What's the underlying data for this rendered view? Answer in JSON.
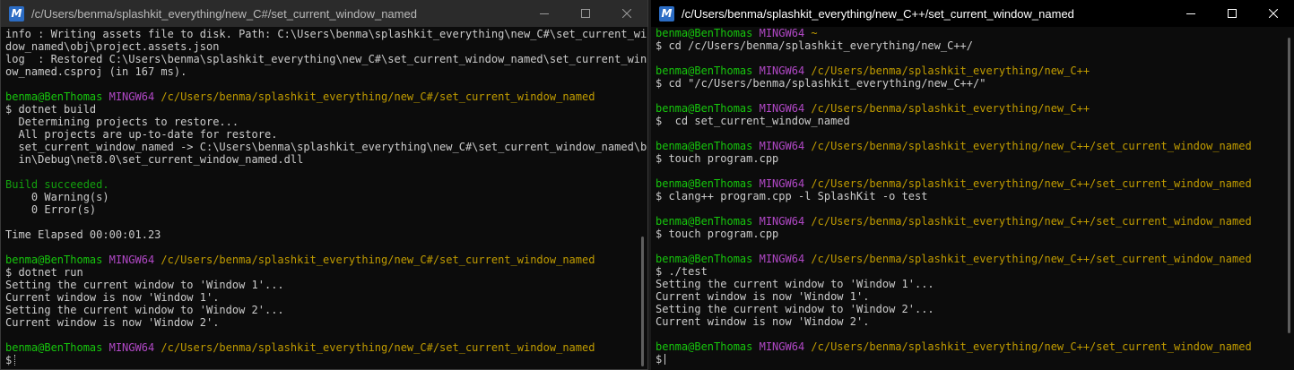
{
  "windows": {
    "left": {
      "title": "/c/Users/benma/splashkit_everything/new_C#/set_current_window_named",
      "icon": "msys2-icon",
      "lines": [
        [
          {
            "t": "info : Writing assets file to disk. Path: C:\\Users\\benma\\splashkit_everything\\new_C#\\set_current_win",
            "c": "white"
          }
        ],
        [
          {
            "t": "dow_named\\obj\\project.assets.json",
            "c": "white"
          }
        ],
        [
          {
            "t": "log  : Restored C:\\Users\\benma\\splashkit_everything\\new_C#\\set_current_window_named\\set_current_wind",
            "c": "white"
          }
        ],
        [
          {
            "t": "ow_named.csproj (in 167 ms).",
            "c": "white"
          }
        ],
        [],
        [
          {
            "t": "benma@BenThomas ",
            "c": "green"
          },
          {
            "t": "MINGW64 ",
            "c": "magenta"
          },
          {
            "t": "/c/Users/benma/splashkit_everything/new_C#/set_current_window_named",
            "c": "yellow"
          }
        ],
        [
          {
            "t": "$ dotnet build",
            "c": "white"
          }
        ],
        [
          {
            "t": "  Determining projects to restore...",
            "c": "white"
          }
        ],
        [
          {
            "t": "  All projects are up-to-date for restore.",
            "c": "white"
          }
        ],
        [
          {
            "t": "  set_current_window_named -> C:\\Users\\benma\\splashkit_everything\\new_C#\\set_current_window_named\\b",
            "c": "white"
          }
        ],
        [
          {
            "t": "  in\\Debug\\net8.0\\set_current_window_named.dll",
            "c": "white"
          }
        ],
        [],
        [
          {
            "t": "Build succeeded.",
            "c": "green2"
          }
        ],
        [
          {
            "t": "    0 Warning(s)",
            "c": "white"
          }
        ],
        [
          {
            "t": "    0 Error(s)",
            "c": "white"
          }
        ],
        [],
        [
          {
            "t": "Time Elapsed 00:00:01.23",
            "c": "white"
          }
        ],
        [],
        [
          {
            "t": "benma@BenThomas ",
            "c": "green"
          },
          {
            "t": "MINGW64 ",
            "c": "magenta"
          },
          {
            "t": "/c/Users/benma/splashkit_everything/new_C#/set_current_window_named",
            "c": "yellow"
          }
        ],
        [
          {
            "t": "$ dotnet run",
            "c": "white"
          }
        ],
        [
          {
            "t": "Setting the current window to 'Window 1'...",
            "c": "white"
          }
        ],
        [
          {
            "t": "Current window is now 'Window 1'.",
            "c": "white"
          }
        ],
        [
          {
            "t": "Setting the current window to 'Window 2'...",
            "c": "white"
          }
        ],
        [
          {
            "t": "Current window is now 'Window 2'.",
            "c": "white"
          }
        ],
        [],
        [
          {
            "t": "benma@BenThomas ",
            "c": "green"
          },
          {
            "t": "MINGW64 ",
            "c": "magenta"
          },
          {
            "t": "/c/Users/benma/splashkit_everything/new_C#/set_current_window_named",
            "c": "yellow"
          }
        ],
        [
          {
            "t": "$",
            "c": "white"
          }
        ]
      ],
      "cursor_style": "dotted"
    },
    "right": {
      "title": "/c/Users/benma/splashkit_everything/new_C++/set_current_window_named",
      "icon": "msys2-icon",
      "lines": [
        [
          {
            "t": "benma@BenThomas ",
            "c": "green"
          },
          {
            "t": "MINGW64 ",
            "c": "magenta"
          },
          {
            "t": "~",
            "c": "yellow"
          }
        ],
        [
          {
            "t": "$ cd /c/Users/benma/splashkit_everything/new_C++/",
            "c": "white"
          }
        ],
        [],
        [
          {
            "t": "benma@BenThomas ",
            "c": "green"
          },
          {
            "t": "MINGW64 ",
            "c": "magenta"
          },
          {
            "t": "/c/Users/benma/splashkit_everything/new_C++",
            "c": "yellow"
          }
        ],
        [
          {
            "t": "$ cd \"/c/Users/benma/splashkit_everything/new_C++/\"",
            "c": "white"
          }
        ],
        [],
        [
          {
            "t": "benma@BenThomas ",
            "c": "green"
          },
          {
            "t": "MINGW64 ",
            "c": "magenta"
          },
          {
            "t": "/c/Users/benma/splashkit_everything/new_C++",
            "c": "yellow"
          }
        ],
        [
          {
            "t": "$  cd set_current_window_named",
            "c": "white"
          }
        ],
        [],
        [
          {
            "t": "benma@BenThomas ",
            "c": "green"
          },
          {
            "t": "MINGW64 ",
            "c": "magenta"
          },
          {
            "t": "/c/Users/benma/splashkit_everything/new_C++/set_current_window_named",
            "c": "yellow"
          }
        ],
        [
          {
            "t": "$ touch program.cpp",
            "c": "white"
          }
        ],
        [],
        [
          {
            "t": "benma@BenThomas ",
            "c": "green"
          },
          {
            "t": "MINGW64 ",
            "c": "magenta"
          },
          {
            "t": "/c/Users/benma/splashkit_everything/new_C++/set_current_window_named",
            "c": "yellow"
          }
        ],
        [
          {
            "t": "$ clang++ program.cpp -l SplashKit -o test",
            "c": "white"
          }
        ],
        [],
        [
          {
            "t": "benma@BenThomas ",
            "c": "green"
          },
          {
            "t": "MINGW64 ",
            "c": "magenta"
          },
          {
            "t": "/c/Users/benma/splashkit_everything/new_C++/set_current_window_named",
            "c": "yellow"
          }
        ],
        [
          {
            "t": "$ touch program.cpp",
            "c": "white"
          }
        ],
        [],
        [
          {
            "t": "benma@BenThomas ",
            "c": "green"
          },
          {
            "t": "MINGW64 ",
            "c": "magenta"
          },
          {
            "t": "/c/Users/benma/splashkit_everything/new_C++/set_current_window_named",
            "c": "yellow"
          }
        ],
        [
          {
            "t": "$ ./test",
            "c": "white"
          }
        ],
        [
          {
            "t": "Setting the current window to 'Window 1'...",
            "c": "white"
          }
        ],
        [
          {
            "t": "Current window is now 'Window 1'.",
            "c": "white"
          }
        ],
        [
          {
            "t": "Setting the current window to 'Window 2'...",
            "c": "white"
          }
        ],
        [
          {
            "t": "Current window is now 'Window 2'.",
            "c": "white"
          }
        ],
        [],
        [
          {
            "t": "benma@BenThomas ",
            "c": "green"
          },
          {
            "t": "MINGW64 ",
            "c": "magenta"
          },
          {
            "t": "/c/Users/benma/splashkit_everything/new_C++/set_current_window_named",
            "c": "yellow"
          }
        ],
        [
          {
            "t": "$",
            "c": "white"
          }
        ]
      ],
      "cursor_style": "bar"
    }
  },
  "controls": {
    "minimize_icon": "minimize-icon",
    "maximize_icon": "maximize-icon",
    "close_icon": "close-icon"
  },
  "colors": {
    "prompt_user": "#16c60c",
    "prompt_system": "#b148c6",
    "prompt_path": "#c19c00",
    "build_success": "#13a10e",
    "text": "#cccccc",
    "background": "#0c0c0c"
  }
}
